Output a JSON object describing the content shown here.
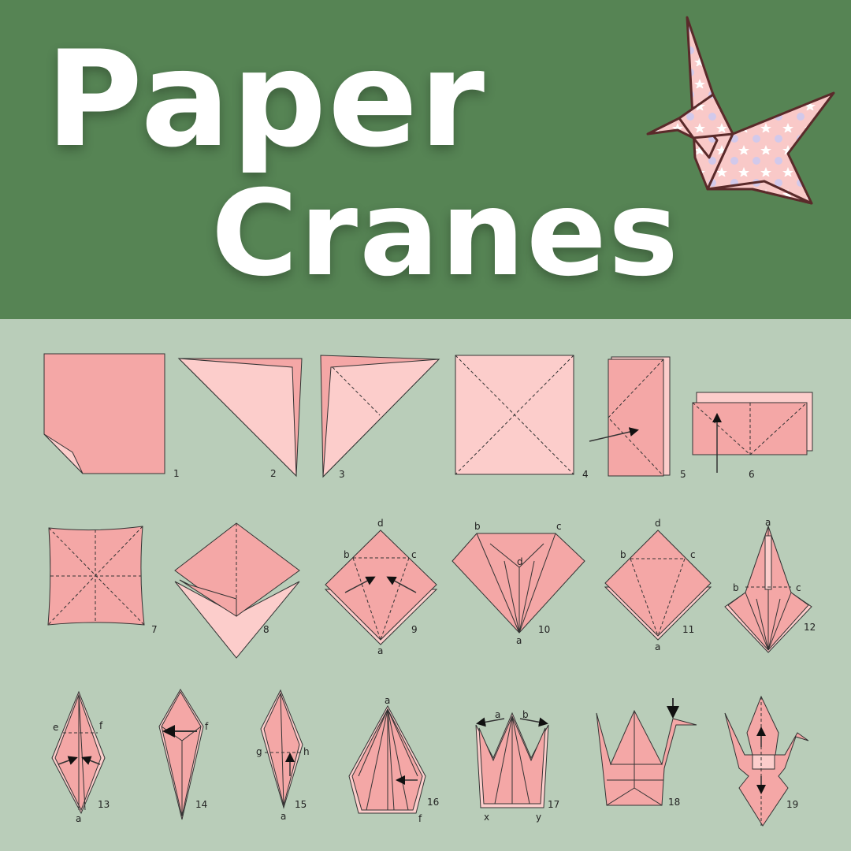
{
  "title": {
    "line1": "Paper",
    "line2": "Cranes"
  },
  "colors": {
    "header_bg": "#568454",
    "panel_bg": "#b9cdb9",
    "paper_dark": "#f4a7a6",
    "paper_light": "#fccdcb",
    "crane_outline": "#5a2a2a"
  },
  "logo": {
    "icon": "origami-crane-icon"
  },
  "steps": [
    {
      "number": "1"
    },
    {
      "number": "2"
    },
    {
      "number": "3"
    },
    {
      "number": "4"
    },
    {
      "number": "5"
    },
    {
      "number": "6"
    },
    {
      "number": "7"
    },
    {
      "number": "8"
    },
    {
      "number": "9",
      "labels": [
        "d",
        "b",
        "c",
        "a"
      ]
    },
    {
      "number": "10",
      "labels": [
        "b",
        "c",
        "d",
        "a"
      ]
    },
    {
      "number": "11",
      "labels": [
        "d",
        "b",
        "c",
        "a"
      ]
    },
    {
      "number": "12",
      "labels": [
        "a",
        "b",
        "c"
      ]
    },
    {
      "number": "13",
      "labels": [
        "e",
        "f",
        "a"
      ]
    },
    {
      "number": "14",
      "labels": [
        "f"
      ]
    },
    {
      "number": "15",
      "labels": [
        "g",
        "h",
        "a"
      ]
    },
    {
      "number": "16",
      "labels": [
        "a",
        "f"
      ]
    },
    {
      "number": "17",
      "labels": [
        "a",
        "b",
        "x",
        "y"
      ]
    },
    {
      "number": "18"
    },
    {
      "number": "19"
    }
  ]
}
